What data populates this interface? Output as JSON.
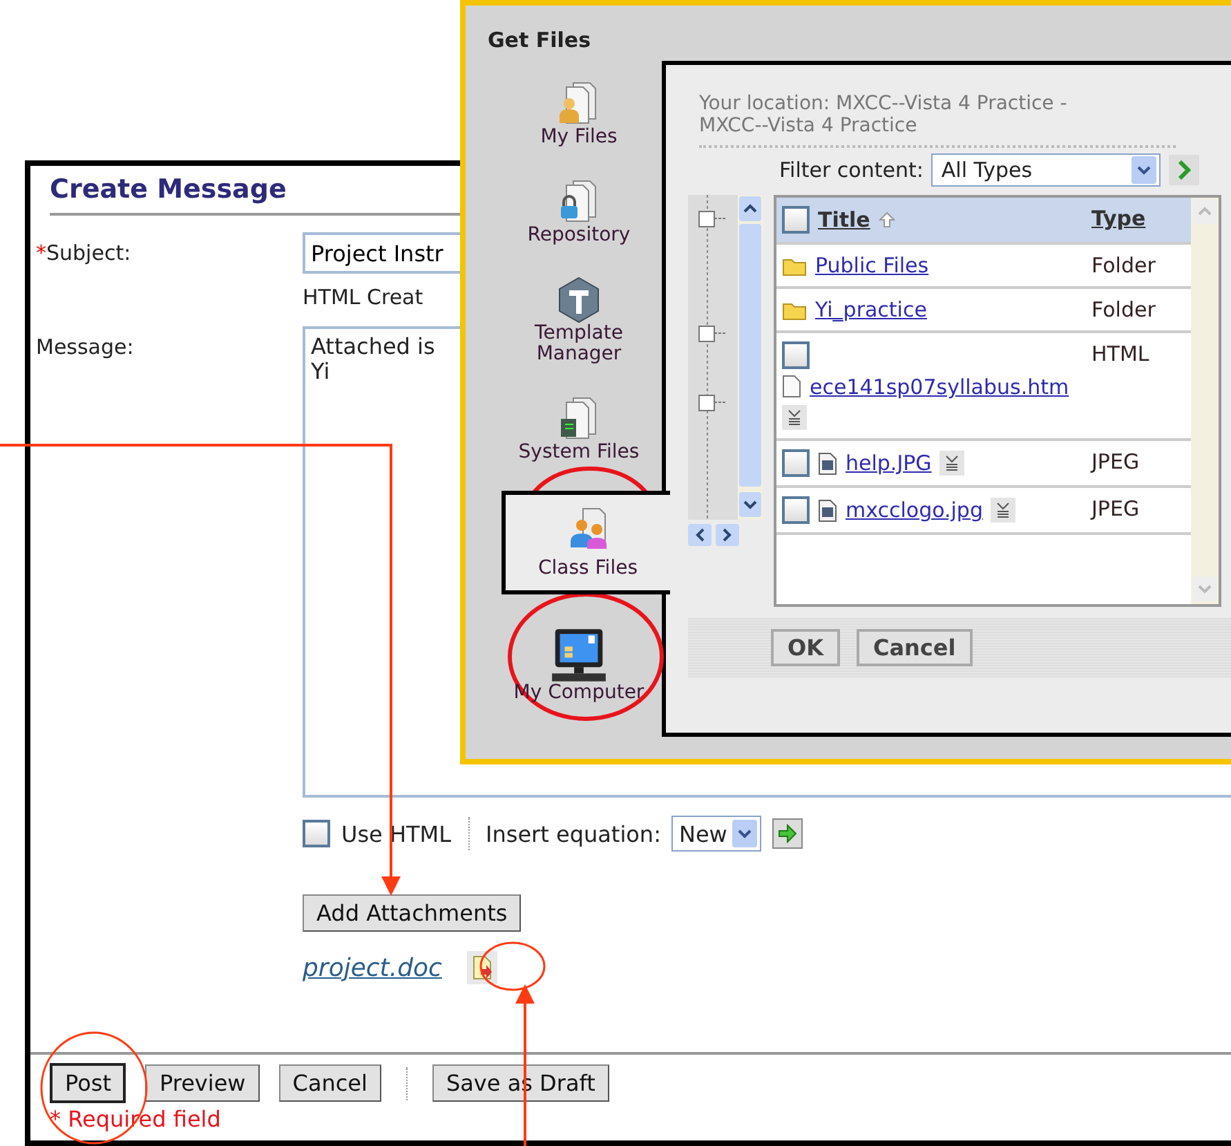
{
  "create_message": {
    "title": "Create Message",
    "subject": {
      "required_mark": "*",
      "label": "Subject:",
      "value": "Project Instr"
    },
    "html_creator": "HTML Creat",
    "message": {
      "label": "Message:",
      "lines": [
        "Attached is",
        "Yi"
      ]
    },
    "use_html": {
      "label": "Use HTML",
      "checked": false
    },
    "insert_equation": {
      "label": "Insert equation:",
      "value": "New"
    },
    "add_attachments": "Add Attachments",
    "attachment": "project.doc",
    "buttons": [
      {
        "label": "Post",
        "default": true
      },
      {
        "label": "Preview",
        "default": false
      },
      {
        "label": "Cancel",
        "default": false
      },
      {
        "label": "Save as Draft",
        "default": false
      }
    ],
    "required_note": "* Required field"
  },
  "get_files": {
    "title": "Get Files",
    "sources": [
      {
        "kind": "person",
        "label": "My Files",
        "selected": false
      },
      {
        "kind": "lock",
        "label": "Repository",
        "selected": false
      },
      {
        "kind": "template",
        "label": "Template Manager",
        "selected": false
      },
      {
        "kind": "system",
        "label": "System Files",
        "selected": false
      },
      {
        "kind": "class",
        "label": "Class Files",
        "selected": true
      },
      {
        "kind": "computer",
        "label": "My Computer",
        "selected": false
      }
    ],
    "location": "Your location: MXCC--Vista 4 Practice - MXCC--Vista 4 Practice",
    "filter": {
      "label": "Filter content:",
      "value": "All Types"
    },
    "table": {
      "select_all": {
        "checked": false
      },
      "columns": [
        "Title",
        "Type"
      ],
      "rows": [
        {
          "kind": "folder",
          "name": "Public Files",
          "type": "Folder"
        },
        {
          "kind": "folder",
          "name": "Yi_practice",
          "type": "Folder"
        },
        {
          "kind": "page",
          "name": "ece141sp07syllabus.htm",
          "type": "HTML",
          "checked": false
        },
        {
          "kind": "image",
          "name": "help.JPG",
          "type": "JPEG",
          "checked": false
        },
        {
          "kind": "image",
          "name": "mxcclogo.jpg",
          "type": "JPEG",
          "checked": false
        }
      ]
    },
    "buttons": [
      "OK",
      "Cancel"
    ]
  }
}
